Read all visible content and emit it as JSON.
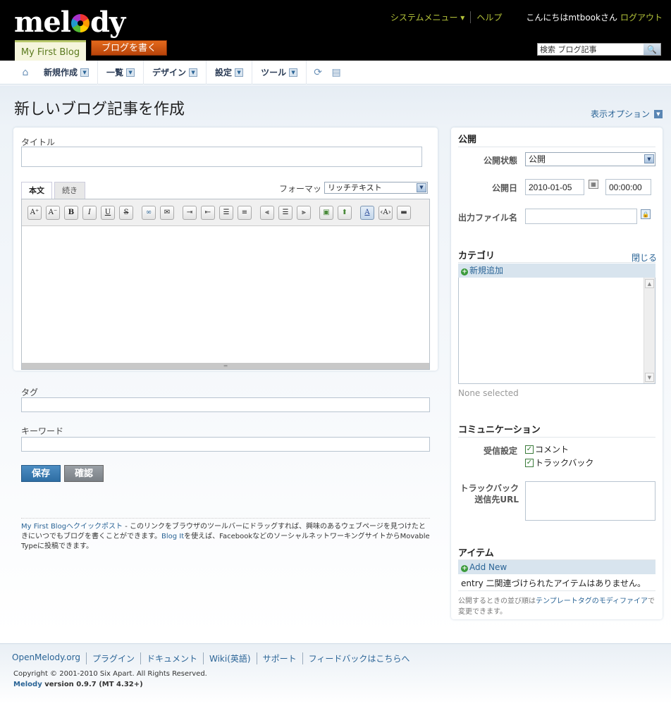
{
  "header": {
    "logo_text": "melody",
    "blog_tab": "My First Blog",
    "write_button": "ブログを書く",
    "system_menu": "システムメニュー ▾",
    "help": "ヘルプ",
    "greeting": "こんにちはmtbookさん",
    "logout": "ログアウト",
    "search_value": "検索 ブログ記事",
    "search_icon": "magnifier-icon"
  },
  "nav": {
    "items": [
      {
        "label": "新規作成"
      },
      {
        "label": "一覧"
      },
      {
        "label": "デザイン"
      },
      {
        "label": "設定"
      },
      {
        "label": "ツール"
      }
    ]
  },
  "page": {
    "title": "新しいブログ記事を作成",
    "display_options": "表示オプション"
  },
  "editor": {
    "title_label": "タイトル",
    "title_value": "",
    "tabs": [
      "本文",
      "続き"
    ],
    "format_label": "フォーマット:",
    "format_value": "リッチテキスト",
    "tag_label": "タグ",
    "keyword_label": "キーワード",
    "save": "保存",
    "confirm": "確認"
  },
  "quickpost": {
    "link1": "My First Blogへクイックポスト",
    "text1": " - このリンクをブラウザのツールバーにドラッグすれば、興味のあるウェブページを見つけたときにいつでもブログを書くことができます。",
    "link2": "Blog It",
    "text2": "を使えば、FacebookなどのソーシャルネットワーキングサイトからMovable Typeに投稿できます。"
  },
  "publish": {
    "heading": "公開",
    "status_label": "公開状態",
    "status_value": "公開",
    "date_label": "公開日",
    "date_value": "2010-01-05",
    "time_value": "00:00:00",
    "filename_label": "出力ファイル名",
    "filename_value": ""
  },
  "category": {
    "heading": "カテゴリ",
    "close": "閉じる",
    "add_new": "新規追加",
    "none_selected": "None selected"
  },
  "communication": {
    "heading": "コミュニケーション",
    "receive_label": "受信設定",
    "comment": "コメント",
    "trackback": "トラックバック",
    "comment_checked": true,
    "trackback_checked": true,
    "tb_url_label_1": "トラックバック",
    "tb_url_label_2": "送信先URL"
  },
  "items": {
    "heading": "アイテム",
    "add_new": "Add New",
    "empty": "entry 二関連づけられたアイテムはありません。",
    "note_pre": "公開するときの並び順は",
    "note_link": "テンプレートタグのモディファイア",
    "note_post": "で変更できます。"
  },
  "footer": {
    "links": [
      "OpenMelody.org",
      "プラグイン",
      "ドキュメント",
      "Wiki(英語)",
      "サポート",
      "フィードバックはこちらへ"
    ],
    "copyright": "Copyright © 2001-2010 Six Apart. All Rights Reserved.",
    "brand": "Melody",
    "version": " version 0.9.7 (MT 4.32+)"
  }
}
